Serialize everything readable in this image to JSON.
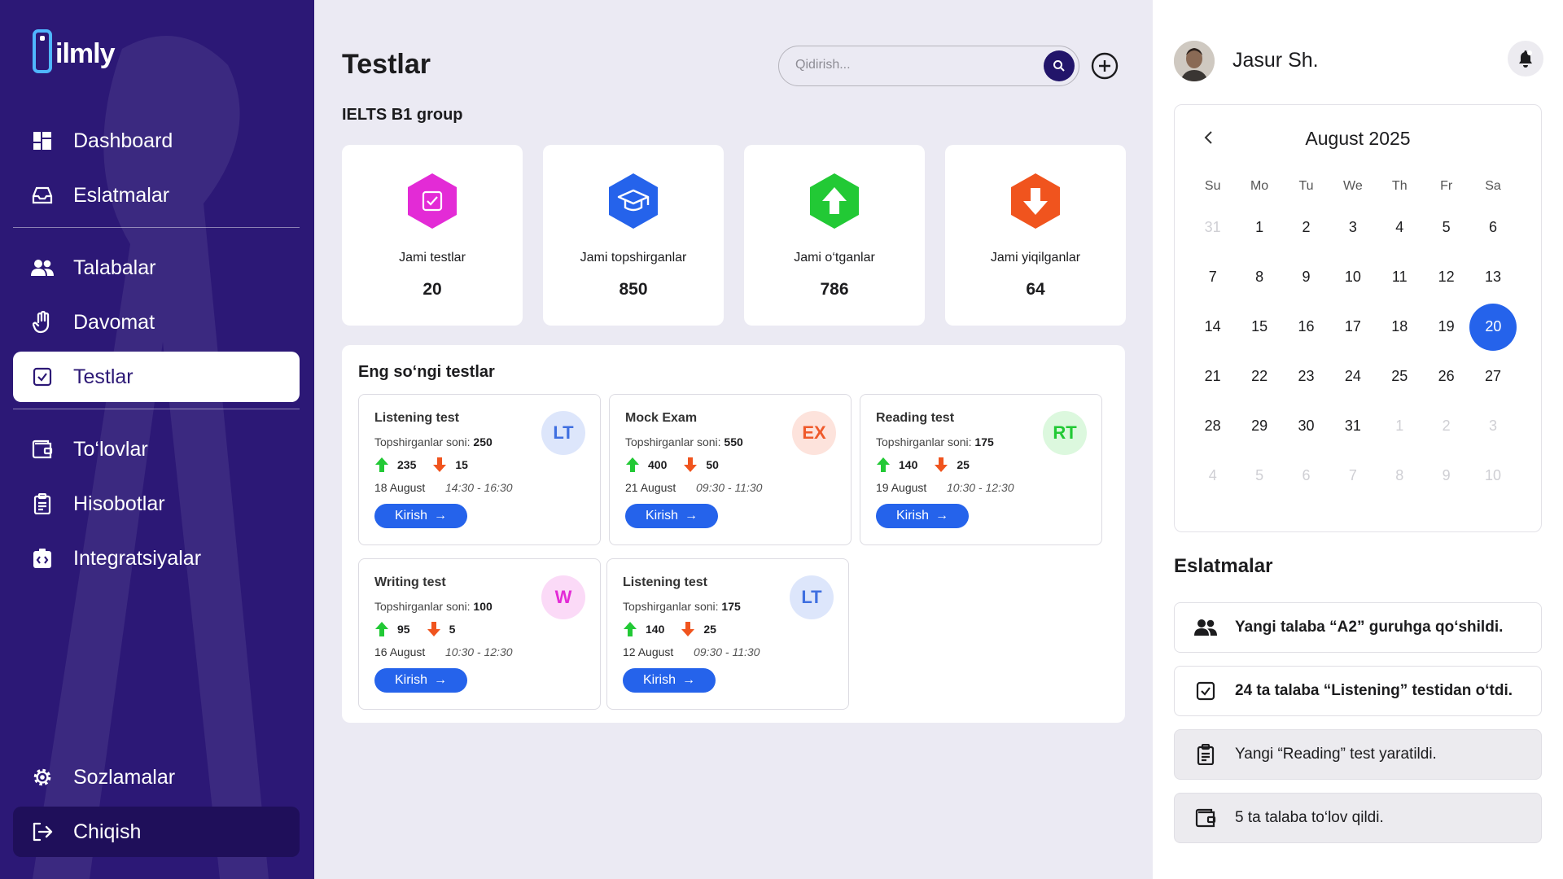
{
  "app": {
    "logo_text": "ilmly"
  },
  "sidebar": {
    "items": [
      {
        "label": "Dashboard",
        "icon": "dashboard-icon"
      },
      {
        "label": "Eslatmalar",
        "icon": "inbox-icon"
      },
      {
        "label": "Talabalar",
        "icon": "users-icon"
      },
      {
        "label": "Davomat",
        "icon": "hand-icon"
      },
      {
        "label": "Testlar",
        "icon": "checkbox-icon",
        "active": true
      },
      {
        "label": "To‘lovlar",
        "icon": "wallet-icon"
      },
      {
        "label": "Hisobotlar",
        "icon": "clipboard-icon"
      },
      {
        "label": "Integratsiyalar",
        "icon": "integration-icon"
      }
    ],
    "bottom": [
      {
        "label": "Sozlamalar",
        "icon": "gear-icon"
      },
      {
        "label": "Chiqish",
        "icon": "logout-icon"
      }
    ]
  },
  "header": {
    "title": "Testlar",
    "search_placeholder": "Qidirish..."
  },
  "group": {
    "title": "IELTS B1 group"
  },
  "stats": [
    {
      "label": "Jami testlar",
      "value": "20",
      "color": "#e32bd6",
      "icon": "checkbox-icon"
    },
    {
      "label": "Jami topshirganlar",
      "value": "850",
      "color": "#2563eb",
      "icon": "graduation-cap-icon"
    },
    {
      "label": "Jami o‘tganlar",
      "value": "786",
      "color": "#22c935",
      "icon": "arrow-up-icon"
    },
    {
      "label": "Jami yiqilganlar",
      "value": "64",
      "color": "#f0541e",
      "icon": "arrow-down-icon"
    }
  ],
  "recent": {
    "title": "Eng so‘ngi testlar",
    "cards": [
      {
        "title": "Listening test",
        "sub_label": "Topshirganlar soni:",
        "count": "250",
        "up": "235",
        "down": "15",
        "date": "18 August",
        "time": "14:30 - 16:30",
        "badge": "LT",
        "badge_bg": "#dde6fb",
        "badge_fg": "#3f6fe0",
        "button": "Kirish"
      },
      {
        "title": "Mock Exam",
        "sub_label": "Topshirganlar soni:",
        "count": "550",
        "up": "400",
        "down": "50",
        "date": "21 August",
        "time": "09:30 - 11:30",
        "badge": "EX",
        "badge_bg": "#fde3dc",
        "badge_fg": "#ef5a2b",
        "button": "Kirish"
      },
      {
        "title": "Reading test",
        "sub_label": "Topshirganlar soni:",
        "count": "175",
        "up": "140",
        "down": "25",
        "date": "19 August",
        "time": "10:30 - 12:30",
        "badge": "RT",
        "badge_bg": "#dcf8de",
        "badge_fg": "#22c935",
        "button": "Kirish"
      },
      {
        "title": "Writing test",
        "sub_label": "Topshirganlar soni:",
        "count": "100",
        "up": "95",
        "down": "5",
        "date": "16 August",
        "time": "10:30 - 12:30",
        "badge": "W",
        "badge_bg": "#fbdaf7",
        "badge_fg": "#e32bd6",
        "button": "Kirish"
      },
      {
        "title": "Listening test",
        "sub_label": "Topshirganlar soni:",
        "count": "175",
        "up": "140",
        "down": "25",
        "date": "12 August",
        "time": "09:30 - 11:30",
        "badge": "LT",
        "badge_bg": "#dde6fb",
        "badge_fg": "#3f6fe0",
        "button": "Kirish"
      }
    ]
  },
  "user": {
    "name": "Jasur Sh."
  },
  "calendar": {
    "month": "August 2025",
    "weekdays": [
      "Su",
      "Mo",
      "Tu",
      "We",
      "Th",
      "Fr",
      "Sa"
    ],
    "weeks": [
      [
        {
          "d": "31",
          "m": true
        },
        {
          "d": "1"
        },
        {
          "d": "2"
        },
        {
          "d": "3"
        },
        {
          "d": "4"
        },
        {
          "d": "5"
        },
        {
          "d": "6"
        }
      ],
      [
        {
          "d": "7"
        },
        {
          "d": "8"
        },
        {
          "d": "9"
        },
        {
          "d": "10"
        },
        {
          "d": "11"
        },
        {
          "d": "12"
        },
        {
          "d": "13"
        }
      ],
      [
        {
          "d": "14"
        },
        {
          "d": "15"
        },
        {
          "d": "16"
        },
        {
          "d": "17"
        },
        {
          "d": "18"
        },
        {
          "d": "19"
        },
        {
          "d": "20",
          "s": true
        }
      ],
      [
        {
          "d": "21"
        },
        {
          "d": "22"
        },
        {
          "d": "23"
        },
        {
          "d": "24"
        },
        {
          "d": "25"
        },
        {
          "d": "26"
        },
        {
          "d": "27"
        }
      ],
      [
        {
          "d": "28"
        },
        {
          "d": "29"
        },
        {
          "d": "30"
        },
        {
          "d": "31"
        },
        {
          "d": "1",
          "m": true
        },
        {
          "d": "2",
          "m": true
        },
        {
          "d": "3",
          "m": true
        }
      ],
      [
        {
          "d": "4",
          "m": true
        },
        {
          "d": "5",
          "m": true
        },
        {
          "d": "6",
          "m": true
        },
        {
          "d": "7",
          "m": true
        },
        {
          "d": "8",
          "m": true
        },
        {
          "d": "9",
          "m": true
        },
        {
          "d": "10",
          "m": true
        }
      ]
    ]
  },
  "notes": {
    "title": "Eslatmalar",
    "items": [
      {
        "text": "Yangi talaba “A2” guruhga qo‘shildi.",
        "icon": "users-icon",
        "bold": true
      },
      {
        "text": "24 ta talaba “Listening” testidan o‘tdi.",
        "icon": "checkbox-icon",
        "bold": true
      },
      {
        "text": "Yangi “Reading” test yaratildi.",
        "icon": "clipboard-icon",
        "bold": false
      },
      {
        "text": "5 ta talaba to‘lov qildi.",
        "icon": "wallet-icon",
        "bold": false
      }
    ]
  }
}
